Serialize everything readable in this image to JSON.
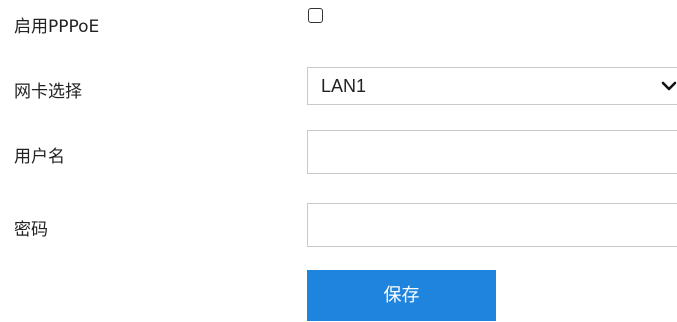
{
  "form": {
    "pppoe": {
      "label": "启用PPPoE",
      "checked": false
    },
    "nic": {
      "label": "网卡选择",
      "selected": "LAN1",
      "options": [
        "LAN1"
      ],
      "icon": "chevron-down-icon"
    },
    "username": {
      "label": "用户名",
      "value": ""
    },
    "password": {
      "label": "密码",
      "value": ""
    },
    "save_label": "保存"
  },
  "colors": {
    "accent": "#1e84dd",
    "text": "#222222",
    "border": "#c9c9c9",
    "button_text": "#ffffff"
  }
}
